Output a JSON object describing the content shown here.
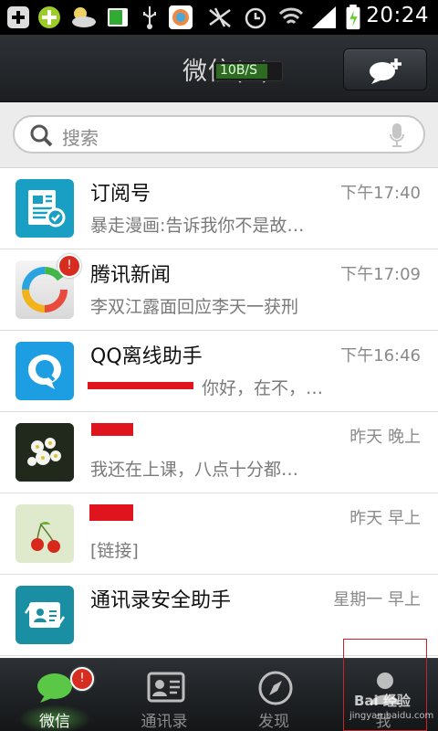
{
  "status_bar": {
    "time": "20:24"
  },
  "header": {
    "title": "微信(1)",
    "speed": "10B/S"
  },
  "search": {
    "placeholder": "搜索"
  },
  "chats": [
    {
      "name": "订阅号",
      "message": "暴走漫画:告诉我你不是故…",
      "time": "下午17:40",
      "avatar": "subscription-icon"
    },
    {
      "name": "腾讯新闻",
      "message": "李双江露面回应李天一获刑",
      "time": "下午17:09",
      "avatar": "tencent-news-icon",
      "badge": "!"
    },
    {
      "name": "QQ离线助手",
      "message": "你好，在不，…",
      "time": "下午16:46",
      "avatar": "qq-offline-assistant-icon"
    },
    {
      "name": "",
      "message": "我还在上课，八点十分都…",
      "time": "昨天 晚上",
      "avatar": "flower-photo"
    },
    {
      "name": "",
      "message": "[链接]",
      "time": "昨天 早上",
      "avatar": "cherry-photo"
    },
    {
      "name": "通讯录安全助手",
      "message": "",
      "time": "星期一 早上",
      "avatar": "contacts-security-icon"
    }
  ],
  "nav": {
    "tabs": [
      {
        "label": "微信",
        "active": true,
        "badge": "!"
      },
      {
        "label": "通讯录",
        "active": false
      },
      {
        "label": "发现",
        "active": false
      },
      {
        "label": "我",
        "active": false
      }
    ]
  },
  "watermark": {
    "text": "Bai 经验",
    "sub": "jingyan.baidu.com"
  },
  "colors": {
    "title_bar": "#23272b",
    "badge": "#d62d20",
    "active_tab_glow": "#5ac846"
  }
}
